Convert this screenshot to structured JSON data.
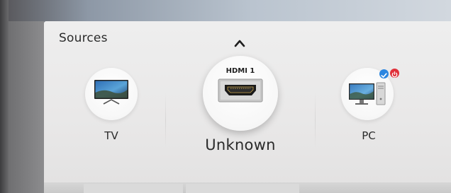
{
  "menu": {
    "title": "Sources"
  },
  "sources": [
    {
      "label": "TV",
      "icon": "tv-icon"
    },
    {
      "label": "Unknown",
      "top_label": "HDMI 1",
      "icon": "hdmi-connector-icon",
      "selected": true
    },
    {
      "label": "PC",
      "icon": "pc-icon",
      "badges": [
        "checkmark-badge-icon",
        "power-badge-icon"
      ]
    }
  ],
  "colors": {
    "panel_background": "#eeeeee",
    "check_badge": "#2b86e0",
    "power_badge": "#e0303a",
    "text": "#2a2a2a"
  }
}
